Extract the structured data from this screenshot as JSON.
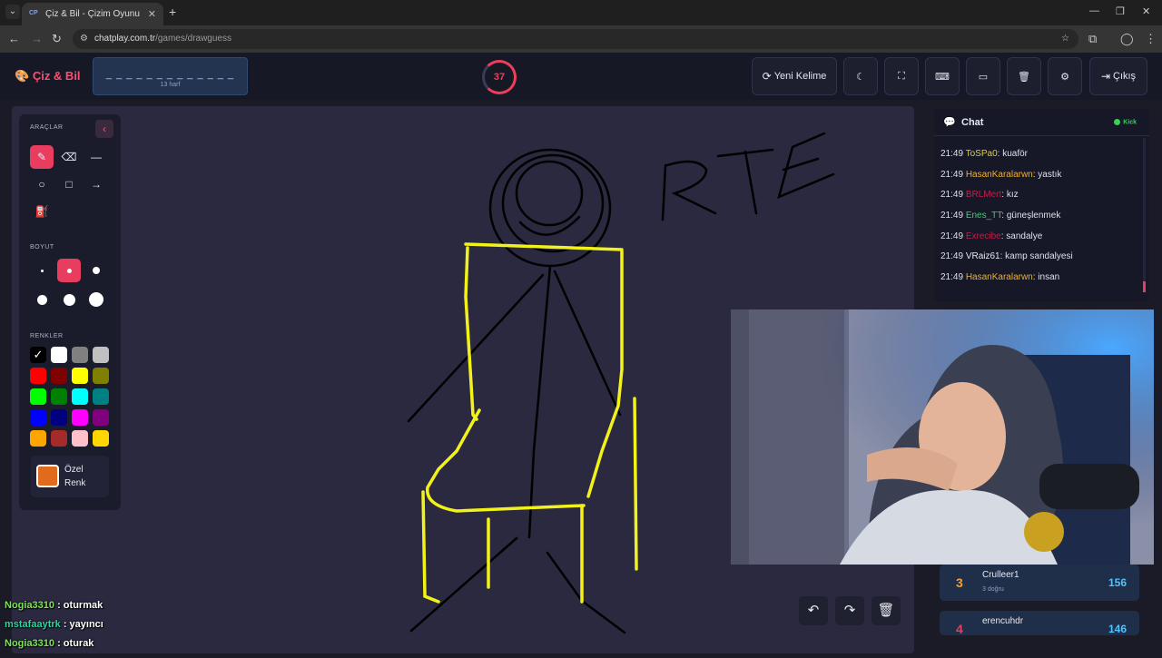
{
  "browser": {
    "tab_title": "Çiz & Bil - Çizim Oyunu",
    "tab_favicon": "CP",
    "url_host": "chatplay.com.tr",
    "url_path": "/games/drawguess"
  },
  "header": {
    "logo": "Çiz & Bil",
    "word_mask": "_ _ _ _ _ _ _ _ _ _ _ _ _",
    "word_hint": "13 harf",
    "timer": "37",
    "timer_progress": 0.75,
    "new_word_label": "Yeni Kelime",
    "exit_label": "Çıkış"
  },
  "tools": {
    "section_tools": "ARAÇLAR",
    "section_size": "BOYUT",
    "section_colors": "RENKLER",
    "custom_color_label1": "Özel",
    "custom_color_label2": "Renk",
    "custom_color": "#e06b1f",
    "selected_tool": "brush",
    "selected_size": 2,
    "palette": [
      "#000000",
      "#ffffff",
      "#808080",
      "#c0c0c0",
      "#ff0000",
      "#800000",
      "#ffff00",
      "#808000",
      "#00ff00",
      "#008000",
      "#00ffff",
      "#008080",
      "#0000ff",
      "#000080",
      "#ff00ff",
      "#800080",
      "#ffa500",
      "#a52a2a",
      "#ffc0cb",
      "#ffd700"
    ]
  },
  "chat": {
    "title": "Chat",
    "platform": "Kick",
    "messages": [
      {
        "time": "21:49",
        "user": "ToSPa0",
        "color": "#e0d040",
        "text": "kuaför"
      },
      {
        "time": "21:49",
        "user": "HasanKaralarwn",
        "color": "#f0b030",
        "text": "yastık"
      },
      {
        "time": "21:49",
        "user": "BRLMert",
        "color": "#c0204a",
        "text": "kız"
      },
      {
        "time": "21:49",
        "user": "Enes_TT",
        "color": "#40d070",
        "text": "güneşlenmek"
      },
      {
        "time": "21:49",
        "user": "Exrecibe",
        "color": "#c0204a",
        "text": "sandalye"
      },
      {
        "time": "21:49",
        "user": "VRaiz61",
        "color": "#e8e8f0",
        "text": "kamp sandalyesi"
      },
      {
        "time": "21:49",
        "user": "HasanKaralarwn",
        "color": "#f0b030",
        "text": "insan"
      }
    ]
  },
  "leaderboard": [
    {
      "rank": "3",
      "name": "Crulleer1",
      "correct": "3 doğru",
      "score": "156"
    },
    {
      "rank": "4",
      "name": "erencuhdr",
      "correct": "",
      "score": "146"
    }
  ],
  "overlay_chat": [
    {
      "user": "Nogia3310",
      "color": "#7fe35a",
      "text": "oturmak"
    },
    {
      "user": "mstafaaytrk",
      "color": "#2fd4a0",
      "text": "yayıncı"
    },
    {
      "user": "Nogia3310",
      "color": "#7fe35a",
      "text": "oturak"
    }
  ],
  "drawing": {
    "text": "RTE",
    "stroke_black": "#000000",
    "stroke_yellow": "#f2f21a"
  }
}
